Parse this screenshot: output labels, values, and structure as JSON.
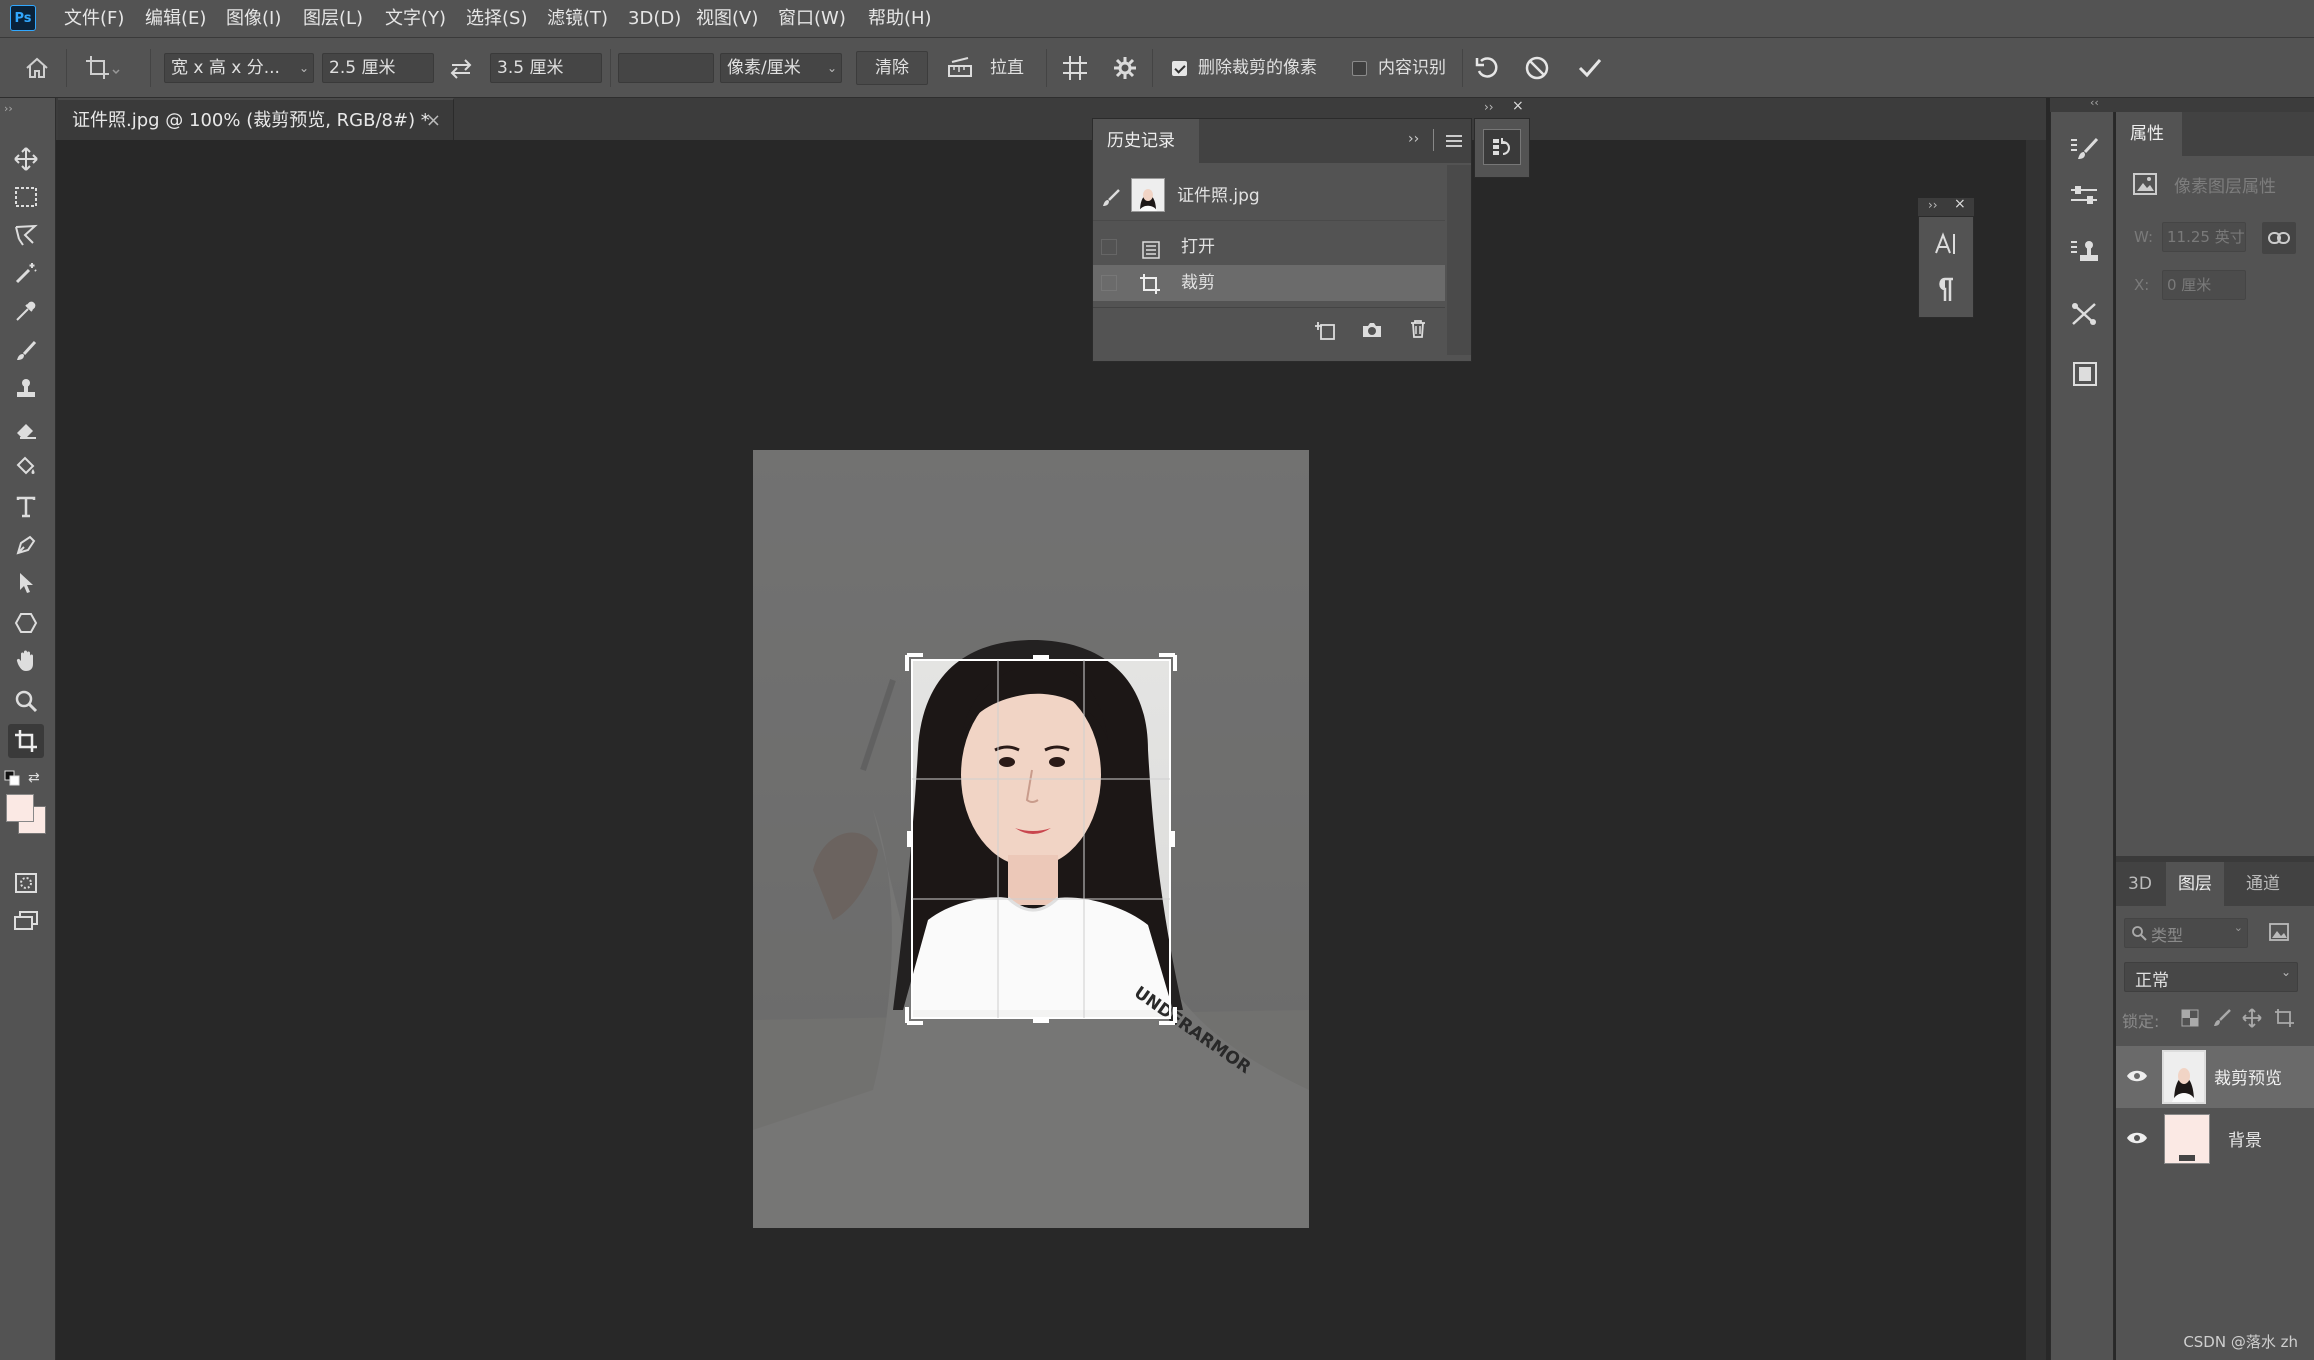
{
  "app": {
    "logo": "Ps"
  },
  "menu": [
    "文件(F)",
    "编辑(E)",
    "图像(I)",
    "图层(L)",
    "文字(Y)",
    "选择(S)",
    "滤镜(T)",
    "3D(D)",
    "视图(V)",
    "窗口(W)",
    "帮助(H)"
  ],
  "options": {
    "ratio_preset": "宽 x 高 x 分...",
    "width": "2.5 厘米",
    "height": "3.5 厘米",
    "resolution": "",
    "resolution_unit": "像素/厘米",
    "clear_label": "清除",
    "straighten_label": "拉直",
    "delete_cropped_label": "删除裁剪的像素",
    "delete_cropped_checked": true,
    "content_aware_label": "内容识别",
    "content_aware_checked": false
  },
  "document": {
    "tab_title": "证件照.jpg @ 100% (裁剪预览, RGB/8#) *",
    "close": "×"
  },
  "history": {
    "title": "历史记录",
    "snapshot": "证件照.jpg",
    "steps": [
      {
        "label": "打开",
        "icon": "document-icon",
        "selected": false
      },
      {
        "label": "裁剪",
        "icon": "crop-icon",
        "selected": true
      }
    ]
  },
  "properties": {
    "title": "属性",
    "subtitle": "像素图层属性",
    "w_label": "W:",
    "w_value": "11.25 英寸",
    "x_label": "X:",
    "x_value": "0 厘米"
  },
  "layers_panel": {
    "tabs": [
      "3D",
      "图层",
      "通道"
    ],
    "active_tab": "图层",
    "filter_placeholder": "类型",
    "blend_mode": "正常",
    "lock_label": "锁定:",
    "layers": [
      {
        "name": "裁剪预览",
        "visible": true,
        "selected": true
      },
      {
        "name": "背景",
        "visible": true,
        "selected": false
      }
    ]
  },
  "colors": {
    "foreground": "#fbe9e4",
    "background": "#fbe9e4",
    "chrome": "#535353",
    "workspace": "#282828"
  },
  "photo": {
    "shirt_text": "UNDERARMOR"
  },
  "watermark": "CSDN @落水 zh"
}
